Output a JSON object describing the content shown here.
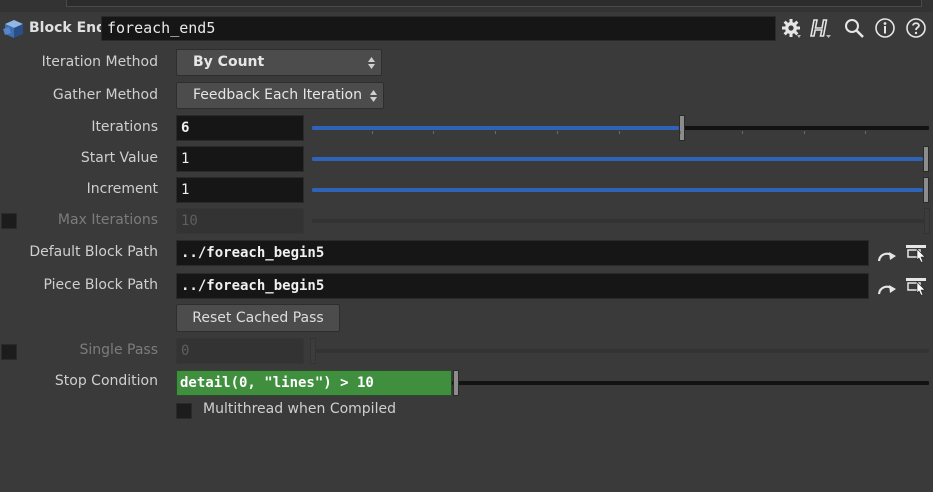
{
  "header": {
    "node_type": "Block End",
    "node_name": "foreach_end5",
    "icons": [
      "cube-icon",
      "gear-icon",
      "houdini-help-icon",
      "magnifier-icon",
      "info-icon",
      "question-icon"
    ]
  },
  "params": {
    "iteration_method": {
      "label": "Iteration Method",
      "value": "By Count"
    },
    "gather_method": {
      "label": "Gather Method",
      "value": "Feedback Each Iteration"
    },
    "iterations": {
      "label": "Iterations",
      "value": "6",
      "slider_fraction": 0.6
    },
    "start_value": {
      "label": "Start Value",
      "value": "1",
      "slider_fraction": 1.0
    },
    "increment": {
      "label": "Increment",
      "value": "1",
      "slider_fraction": 1.0
    },
    "max_iterations": {
      "label": "Max Iterations",
      "value": "10",
      "enabled": false
    },
    "default_block_path": {
      "label": "Default Block Path",
      "value": "../foreach_begin5"
    },
    "piece_block_path": {
      "label": "Piece Block Path",
      "value": "../foreach_begin5"
    },
    "reset_button": {
      "label": "Reset Cached Pass"
    },
    "single_pass": {
      "label": "Single Pass",
      "value": "0",
      "enabled": false
    },
    "stop_condition": {
      "label": "Stop Condition",
      "value": "detail(0, \"lines\") > 10"
    },
    "multithread": {
      "label": "Multithread when Compiled",
      "checked": false
    }
  },
  "colors": {
    "background": "#3a3a3a",
    "field": "#161616",
    "slider_fill": "#2e63b8",
    "expression_green": "#3f8f3f"
  }
}
